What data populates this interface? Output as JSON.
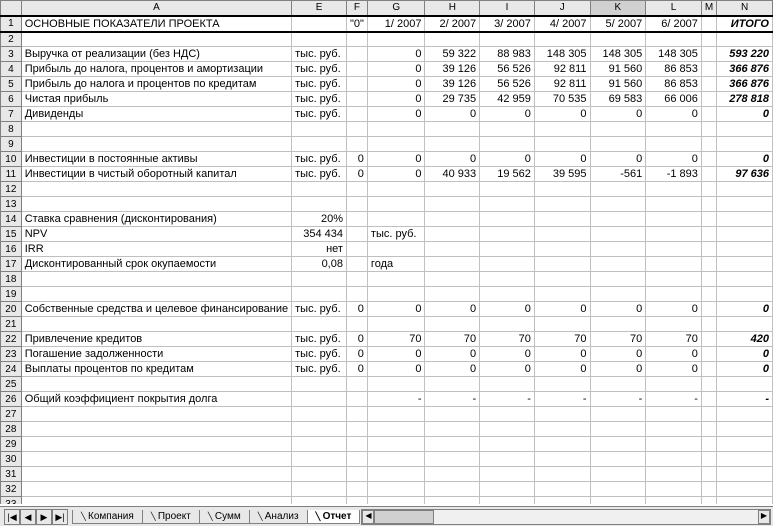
{
  "columns": [
    "A",
    "E",
    "F",
    "G",
    "H",
    "I",
    "J",
    "K",
    "L",
    "M",
    "N"
  ],
  "selected_col": "K",
  "title": "ОСНОВНЫЕ ПОКАЗАТЕЛИ ПРОЕКТА",
  "periods": {
    "F": "\"0\"",
    "G": "1/ 2007",
    "H": "2/ 2007",
    "I": "3/ 2007",
    "J": "4/ 2007",
    "K": "5/ 2007",
    "L": "6/ 2007",
    "N": "ИТОГО"
  },
  "rows": [
    {
      "n": 3,
      "A": "Выручка от реализации (без НДС)",
      "E": "тыс. руб.",
      "G": "0",
      "H": "59 322",
      "I": "88 983",
      "J": "148 305",
      "K": "148 305",
      "L": "148 305",
      "N": "593 220"
    },
    {
      "n": 4,
      "A": "Прибыль до налога, процентов и амортизации",
      "E": "тыс. руб.",
      "G": "0",
      "H": "39 126",
      "I": "56 526",
      "J": "92 811",
      "K": "91 560",
      "L": "86 853",
      "N": "366 876"
    },
    {
      "n": 5,
      "A": "Прибыль до налога и процентов по кредитам",
      "E": "тыс. руб.",
      "G": "0",
      "H": "39 126",
      "I": "56 526",
      "J": "92 811",
      "K": "91 560",
      "L": "86 853",
      "N": "366 876"
    },
    {
      "n": 6,
      "A": "Чистая прибыль",
      "E": "тыс. руб.",
      "G": "0",
      "H": "29 735",
      "I": "42 959",
      "J": "70 535",
      "K": "69 583",
      "L": "66 006",
      "N": "278 818"
    },
    {
      "n": 7,
      "A": "Дивиденды",
      "E": "тыс. руб.",
      "G": "0",
      "H": "0",
      "I": "0",
      "J": "0",
      "K": "0",
      "L": "0",
      "N": "0"
    },
    {
      "n": 8
    },
    {
      "n": 9
    },
    {
      "n": 10,
      "A": "Инвестиции в постоянные активы",
      "E": "тыс. руб.",
      "F": "0",
      "G": "0",
      "H": "0",
      "I": "0",
      "J": "0",
      "K": "0",
      "L": "0",
      "N": "0"
    },
    {
      "n": 11,
      "A": "Инвестиции в чистый оборотный капитал",
      "E": "тыс. руб.",
      "F": "0",
      "G": "0",
      "H": "40 933",
      "I": "19 562",
      "J": "39 595",
      "K": "-561",
      "L": "-1 893",
      "N": "97 636"
    },
    {
      "n": 12
    },
    {
      "n": 13
    },
    {
      "n": 14,
      "A": "Ставка сравнения (дисконтирования)",
      "E": "20%"
    },
    {
      "n": 15,
      "A": "NPV",
      "E": "354 434",
      "G": "тыс. руб."
    },
    {
      "n": 16,
      "A": "IRR",
      "E": "нет"
    },
    {
      "n": 17,
      "A": "Дисконтированный срок окупаемости",
      "E": "0,08",
      "G": "года"
    },
    {
      "n": 18
    },
    {
      "n": 19
    },
    {
      "n": 20,
      "A": "Собственные средства и целевое финансирование",
      "E": "тыс. руб.",
      "F": "0",
      "G": "0",
      "H": "0",
      "I": "0",
      "J": "0",
      "K": "0",
      "L": "0",
      "N": "0"
    },
    {
      "n": 21
    },
    {
      "n": 22,
      "A": "Привлечение кредитов",
      "E": "тыс. руб.",
      "F": "0",
      "G": "70",
      "H": "70",
      "I": "70",
      "J": "70",
      "K": "70",
      "L": "70",
      "N": "420"
    },
    {
      "n": 23,
      "A": "Погашение задолженности",
      "E": "тыс. руб.",
      "F": "0",
      "G": "0",
      "H": "0",
      "I": "0",
      "J": "0",
      "K": "0",
      "L": "0",
      "N": "0"
    },
    {
      "n": 24,
      "A": "Выплаты процентов по кредитам",
      "E": "тыс. руб.",
      "F": "0",
      "G": "0",
      "H": "0",
      "I": "0",
      "J": "0",
      "K": "0",
      "L": "0",
      "N": "0"
    },
    {
      "n": 25
    },
    {
      "n": 26,
      "A": "Общий коэффициент покрытия долга",
      "G": "-",
      "H": "-",
      "I": "-",
      "J": "-",
      "K": "-",
      "L": "-",
      "N": "-"
    },
    {
      "n": 27
    },
    {
      "n": 28
    },
    {
      "n": 29
    },
    {
      "n": 30
    },
    {
      "n": 31
    },
    {
      "n": 32
    },
    {
      "n": 33
    }
  ],
  "tabs": [
    "Компания",
    "Проект",
    "Сумм",
    "Анализ",
    "Отчет"
  ],
  "active_tab": "Отчет",
  "nav_icons": {
    "first": "|◀",
    "prev": "◀",
    "next": "▶",
    "last": "▶|"
  }
}
